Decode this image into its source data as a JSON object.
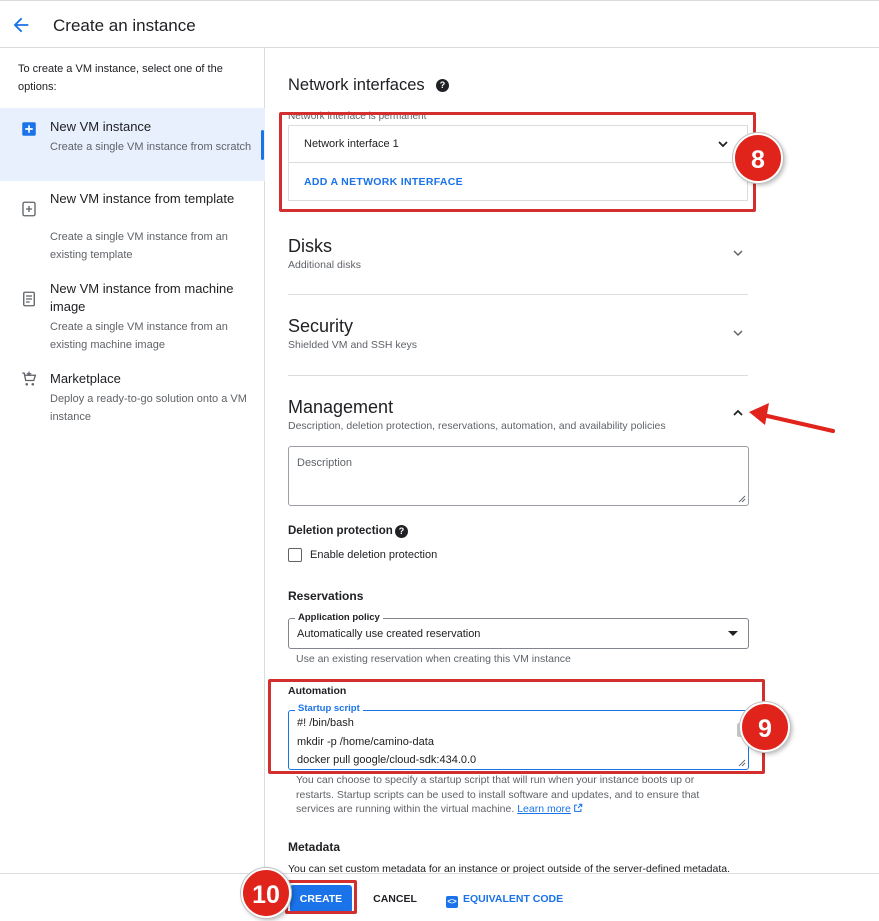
{
  "header": {
    "title": "Create an instance"
  },
  "sidebar": {
    "intro": "To create a VM instance, select one of the options:",
    "options": [
      {
        "title": "New VM instance",
        "desc": "Create a single VM instance from scratch",
        "icon": "add-box-icon",
        "active": true
      },
      {
        "title": "New VM instance from template",
        "desc": "Create a single VM instance from an existing template",
        "icon": "template-icon"
      },
      {
        "title": "New VM instance from machine image",
        "desc": "Create a single VM instance from an existing machine image",
        "icon": "machine-image-icon"
      },
      {
        "title": "Marketplace",
        "desc": "Deploy a ready-to-go solution onto a VM instance",
        "icon": "cart-icon"
      }
    ]
  },
  "network": {
    "title": "Network interfaces",
    "permanent_note": "Network interface is permanent",
    "interface": "Network interface 1",
    "add": "ADD A NETWORK INTERFACE"
  },
  "disks": {
    "title": "Disks",
    "sub": "Additional disks"
  },
  "security": {
    "title": "Security",
    "sub": "Shielded VM and SSH keys"
  },
  "management": {
    "title": "Management",
    "sub": "Description, deletion protection, reservations, automation, and availability policies",
    "description_placeholder": "Description",
    "deletion_title": "Deletion protection",
    "deletion_checkbox": "Enable deletion protection",
    "reservations_title": "Reservations",
    "policy_label": "Application policy",
    "policy_value": "Automatically use created reservation",
    "policy_hint": "Use an existing reservation when creating this VM instance",
    "automation_title": "Automation",
    "startup_label": "Startup script",
    "script_lines": [
      "#! /bin/bash",
      "mkdir -p /home/camino-data",
      "docker pull google/cloud-sdk:434.0.0"
    ],
    "startup_help": "You can choose to specify a startup script that will run when your instance boots up or restarts. Startup scripts can be used to install software and updates, and to ensure that services are running within the virtual machine.",
    "learn_more": "Learn more"
  },
  "metadata": {
    "title": "Metadata",
    "desc": "You can set custom metadata for an instance or project outside of the server-defined metadata."
  },
  "footer": {
    "create": "CREATE",
    "cancel": "CANCEL",
    "equivalent_code": "EQUIVALENT CODE"
  },
  "annotations": {
    "badge_8": "8",
    "badge_9": "9",
    "badge_10": "10",
    "highlight_color": "#d32f2f"
  },
  "colors": {
    "accent": "#1a73e8",
    "active_bg": "#e8f0fe",
    "annotation_red": "#e0241b"
  }
}
